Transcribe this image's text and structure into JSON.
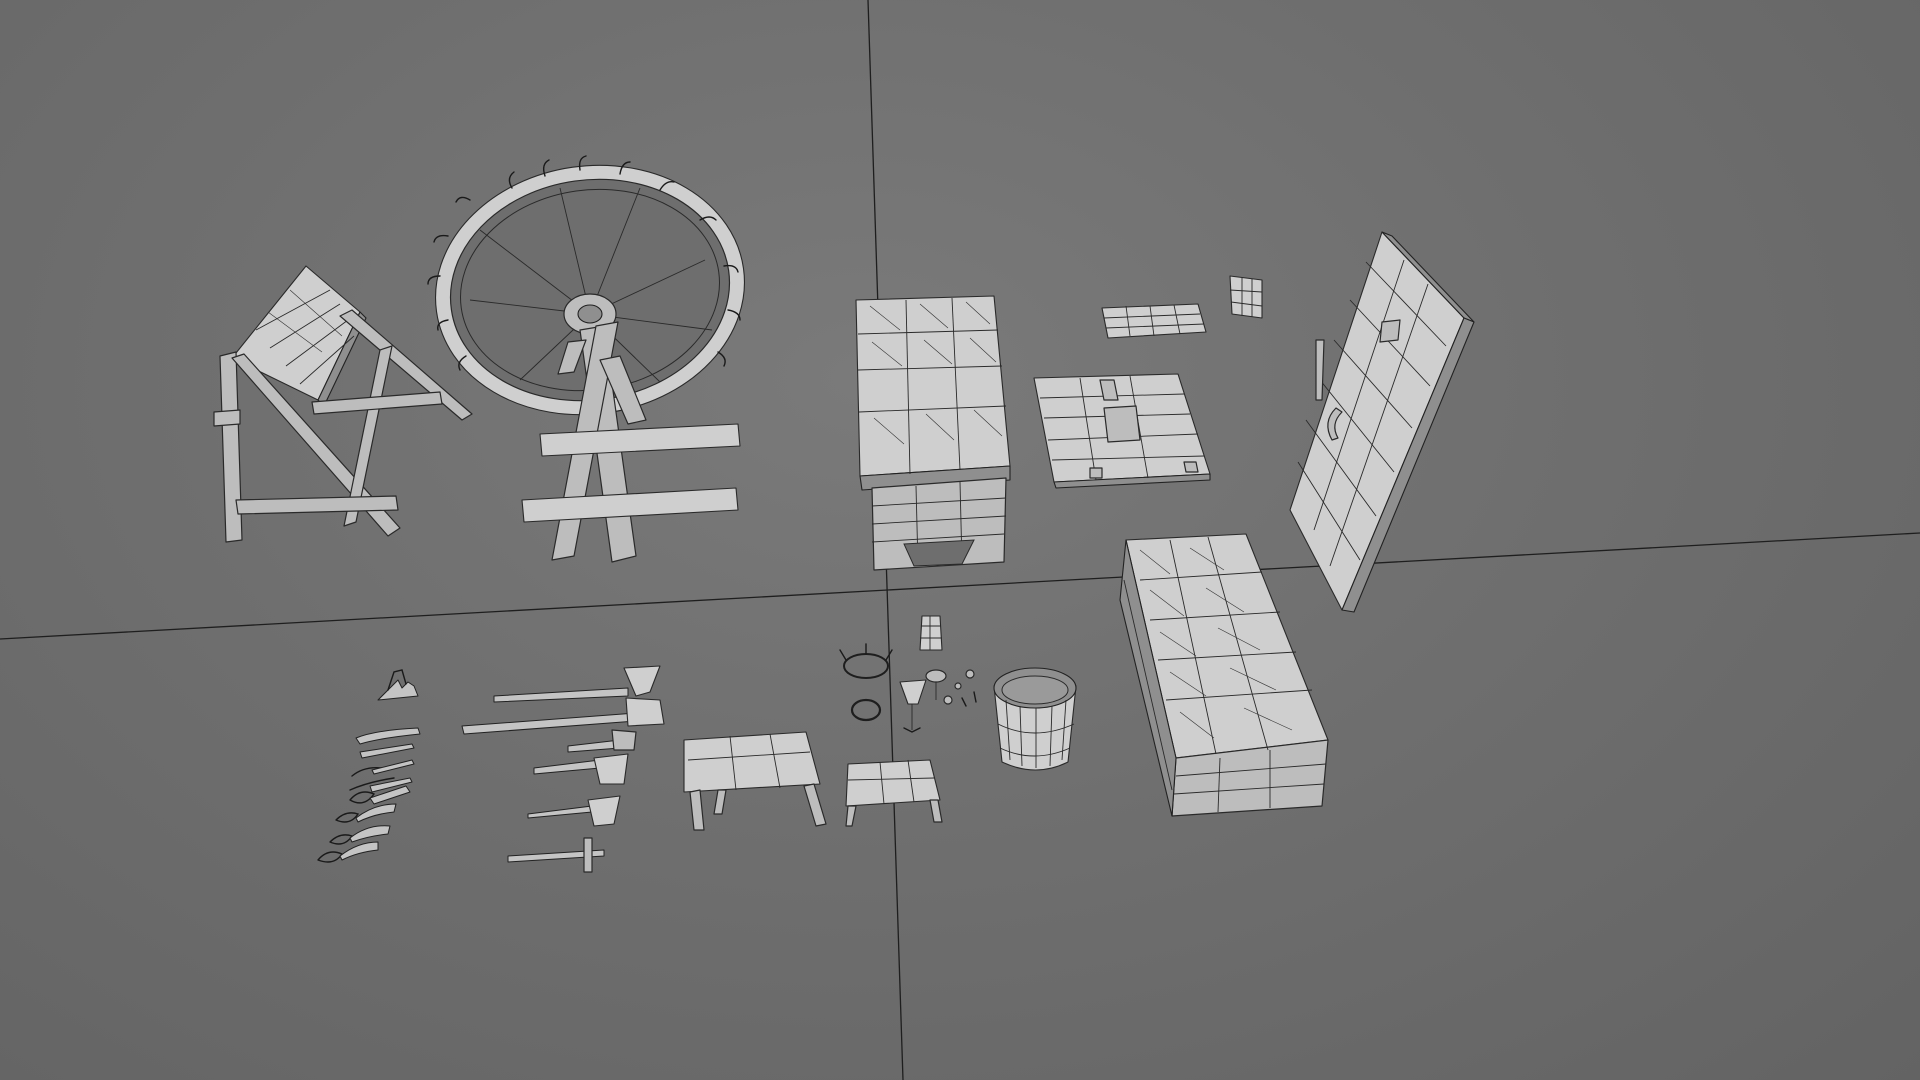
{
  "viewport": {
    "background": "#6e6e6e",
    "grid_axis_color": "#1e1e1e",
    "mesh_fill": "#c0c0c0",
    "wire_color": "#2a2a2a",
    "display_mode": "wireframe-on-shaded"
  },
  "objects": [
    "stool-frame",
    "spinning-wheel",
    "workbench-table",
    "small-crate-board",
    "small-cube",
    "floor-hatch",
    "wooden-door",
    "storage-chest",
    "hand-tools-set",
    "weapons-set",
    "small-bench",
    "footstool",
    "candle-holder",
    "lantern",
    "iron-ring",
    "small-props",
    "wooden-bucket"
  ]
}
